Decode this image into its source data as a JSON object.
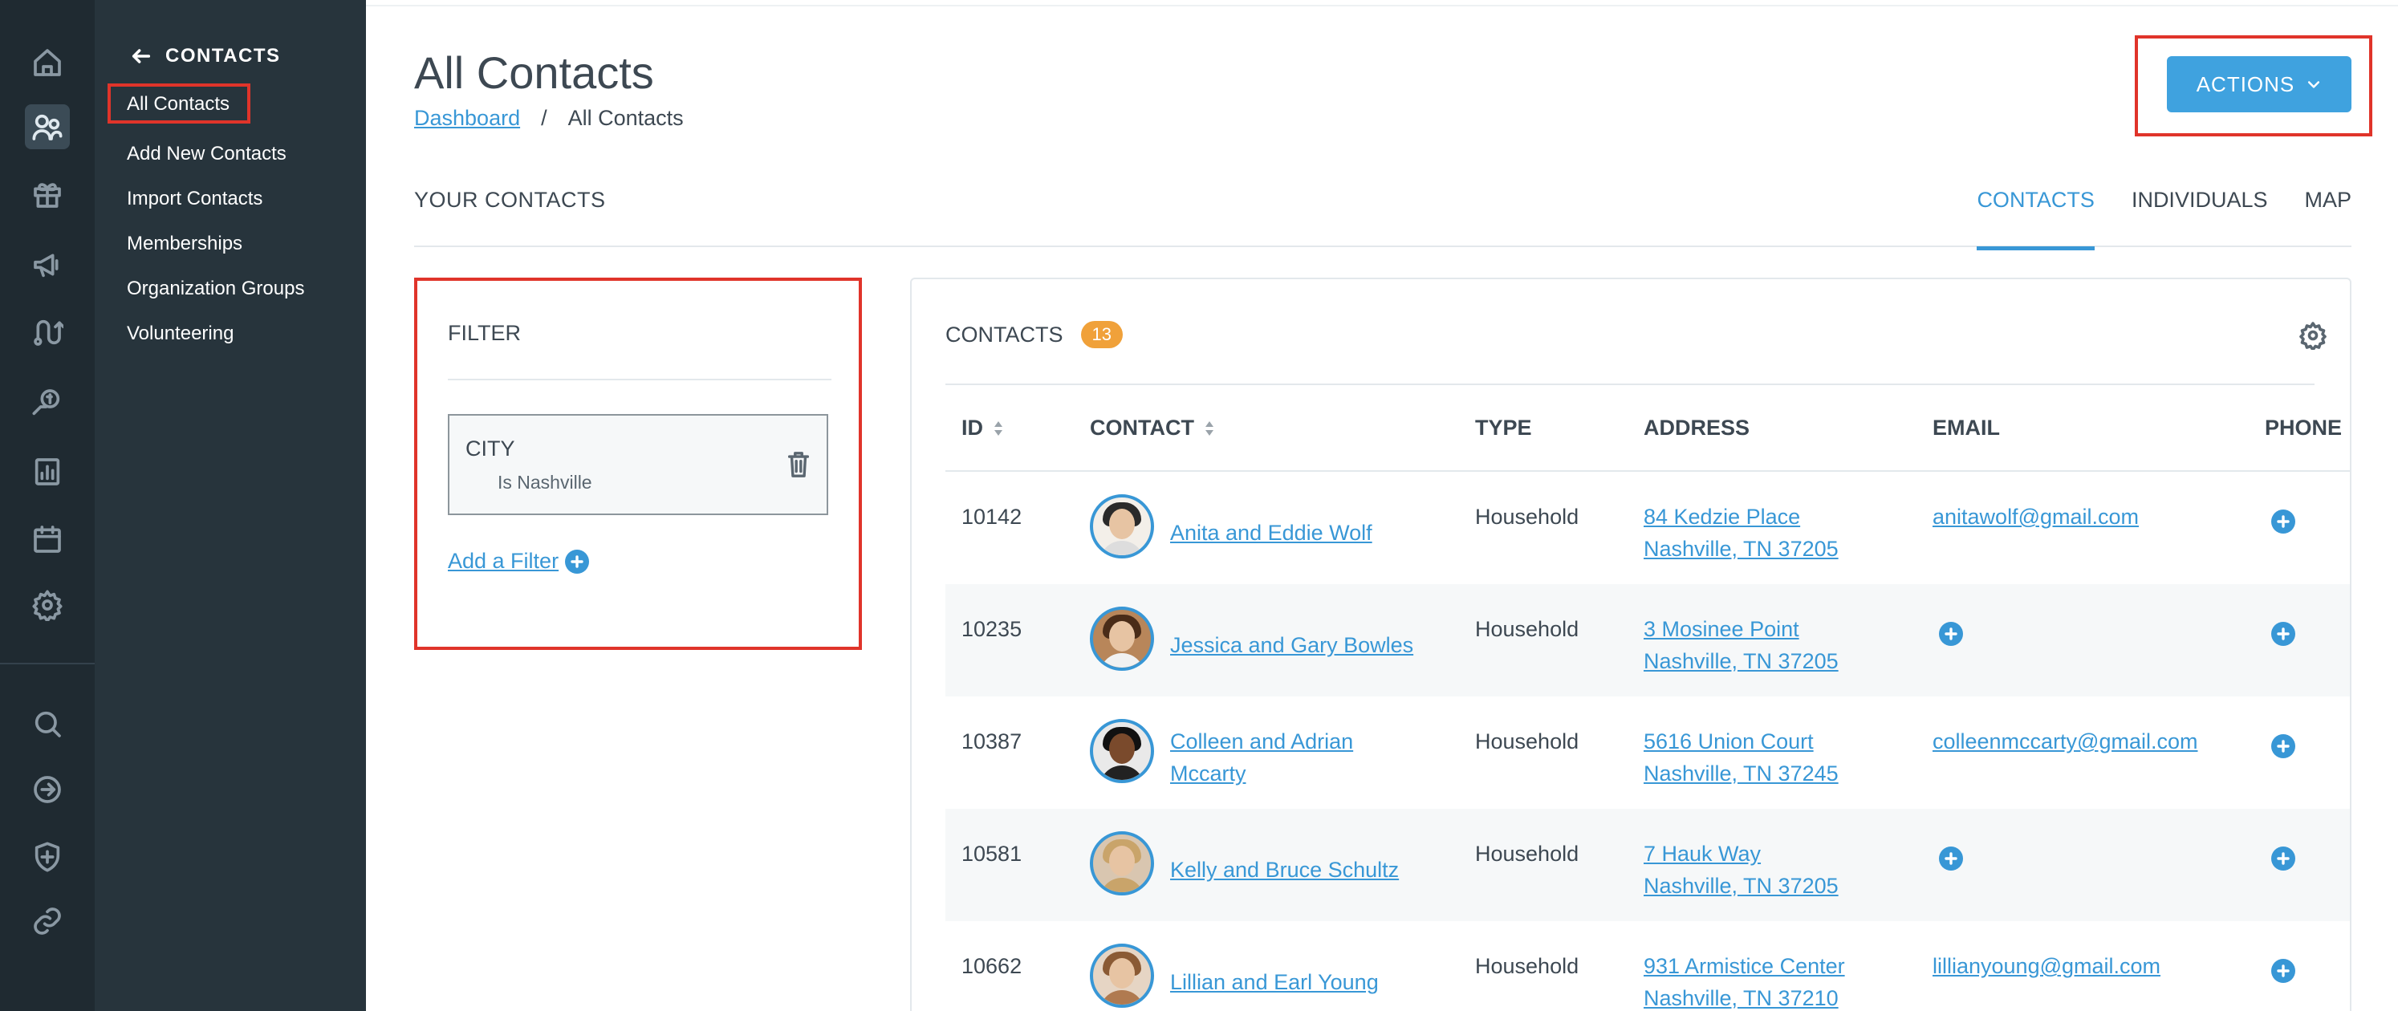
{
  "rail": {
    "icons": [
      "home-icon",
      "contacts-icon",
      "gift-icon",
      "megaphone-icon",
      "route-icon",
      "donation-icon",
      "reports-icon",
      "calendar-icon",
      "settings-icon",
      "search-icon",
      "login-icon",
      "shield-plus-icon",
      "link-icon"
    ],
    "active": "contacts-icon"
  },
  "subnav": {
    "heading": "CONTACTS",
    "items": [
      "All Contacts",
      "Add New Contacts",
      "Import Contacts",
      "Memberships",
      "Organization Groups",
      "Volunteering"
    ],
    "selected": "All Contacts"
  },
  "header": {
    "title": "All Contacts",
    "breadcrumb_link": "Dashboard",
    "breadcrumb_sep": "/",
    "breadcrumb_current": "All Contacts",
    "actions_label": "ACTIONS"
  },
  "section": {
    "label": "YOUR CONTACTS",
    "tabs": [
      "CONTACTS",
      "INDIVIDUALS",
      "MAP"
    ],
    "active_tab": "CONTACTS"
  },
  "filter": {
    "title": "FILTER",
    "field": "CITY",
    "condition": "Is Nashville",
    "add_label": "Add a Filter"
  },
  "contacts": {
    "title": "CONTACTS",
    "count": "13",
    "columns": [
      "ID",
      "CONTACT",
      "TYPE",
      "ADDRESS",
      "EMAIL",
      "PHONE"
    ],
    "rows": [
      {
        "id": "10142",
        "name_line1": "Anita and Eddie Wolf",
        "name_line2": "",
        "type": "Household",
        "addr1": "84 Kedzie Place",
        "addr2": "Nashville, TN 37205",
        "email": "anitawolf@gmail.com"
      },
      {
        "id": "10235",
        "name_line1": "Jessica and Gary Bowles",
        "name_line2": "",
        "type": "Household",
        "addr1": "3 Mosinee Point",
        "addr2": "Nashville, TN 37205",
        "email": ""
      },
      {
        "id": "10387",
        "name_line1": "Colleen and Adrian",
        "name_line2": "Mccarty",
        "type": "Household",
        "addr1": "5616 Union Court",
        "addr2": "Nashville, TN 37245",
        "email": "colleenmccarty@gmail.com"
      },
      {
        "id": "10581",
        "name_line1": "Kelly and Bruce Schultz",
        "name_line2": "",
        "type": "Household",
        "addr1": "7 Hauk Way",
        "addr2": "Nashville, TN 37205",
        "email": ""
      },
      {
        "id": "10662",
        "name_line1": "Lillian and Earl Young",
        "name_line2": "",
        "type": "Household",
        "addr1": "931 Armistice Center",
        "addr2": "Nashville, TN 37210",
        "email": "lillianyoung@gmail.com"
      }
    ]
  },
  "colors": {
    "accent": "#3897d6",
    "highlight": "#e0342a",
    "badge": "#f0a13a",
    "sidebar": "#27343c",
    "rail": "#1f2a31"
  }
}
